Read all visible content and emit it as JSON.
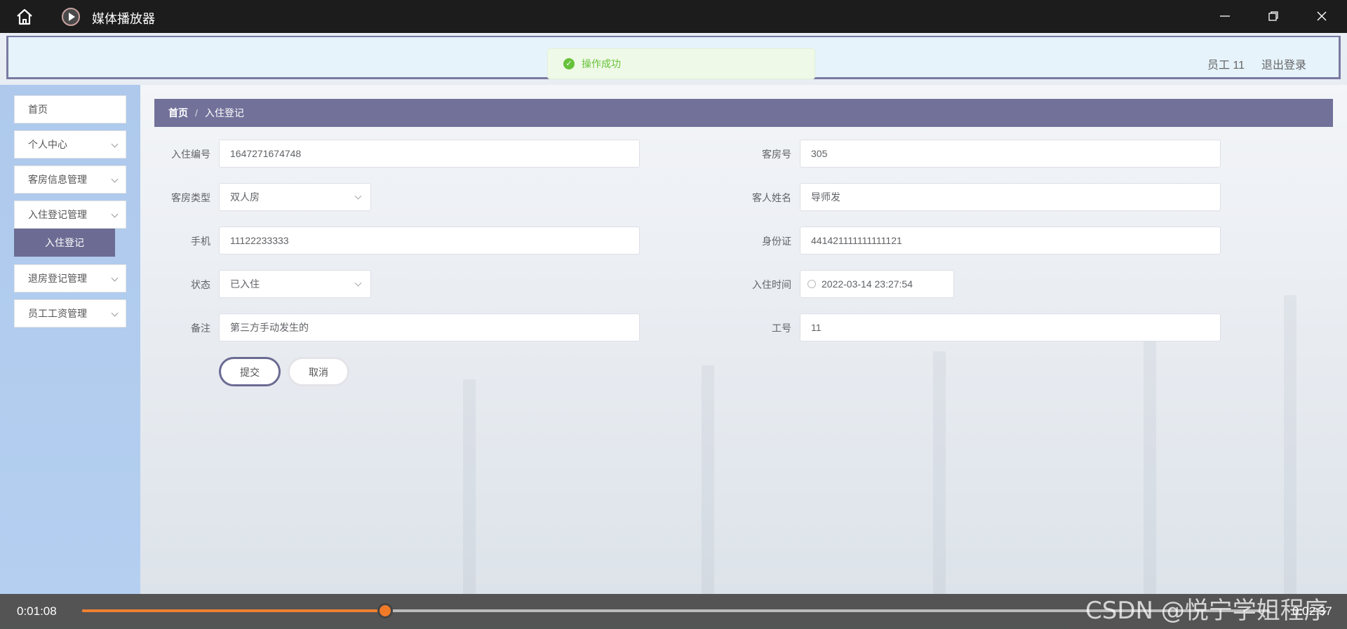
{
  "player": {
    "title": "媒体播放器",
    "current_time": "0:01:08",
    "total_time": "0:02:37",
    "progress": 0.255,
    "accent": "#f08030"
  },
  "header": {
    "toast": "操作成功",
    "user": "员工 11",
    "logout": "退出登录"
  },
  "sidebar": {
    "items": [
      {
        "label": "首页"
      },
      {
        "label": "个人中心"
      },
      {
        "label": "客房信息管理"
      },
      {
        "label": "入住登记管理"
      },
      {
        "label": "入住登记"
      },
      {
        "label": "退房登记管理"
      },
      {
        "label": "员工工资管理"
      }
    ]
  },
  "breadcrumb": {
    "home": "首页",
    "separator": "/",
    "current": "入住登记"
  },
  "form": {
    "checkin_no": {
      "label": "入住编号",
      "value": "1647271674748"
    },
    "room_no": {
      "label": "客房号",
      "value": "305"
    },
    "room_type": {
      "label": "客房类型",
      "value": "双人房"
    },
    "guest_name": {
      "label": "客人姓名",
      "value": "导师发"
    },
    "phone": {
      "label": "手机",
      "value": "11122233333"
    },
    "id_card": {
      "label": "身份证",
      "value": "441421111111111121"
    },
    "status": {
      "label": "状态",
      "value": "已入住"
    },
    "checkin_time": {
      "label": "入住时间",
      "value": "2022-03-14 23:27:54"
    },
    "remark": {
      "label": "备注",
      "value": "第三方手动发生的"
    },
    "staff_no": {
      "label": "工号",
      "value": "11"
    },
    "submit": "提交",
    "cancel": "取消"
  },
  "watermark": "CSDN @悦宁学姐程序"
}
